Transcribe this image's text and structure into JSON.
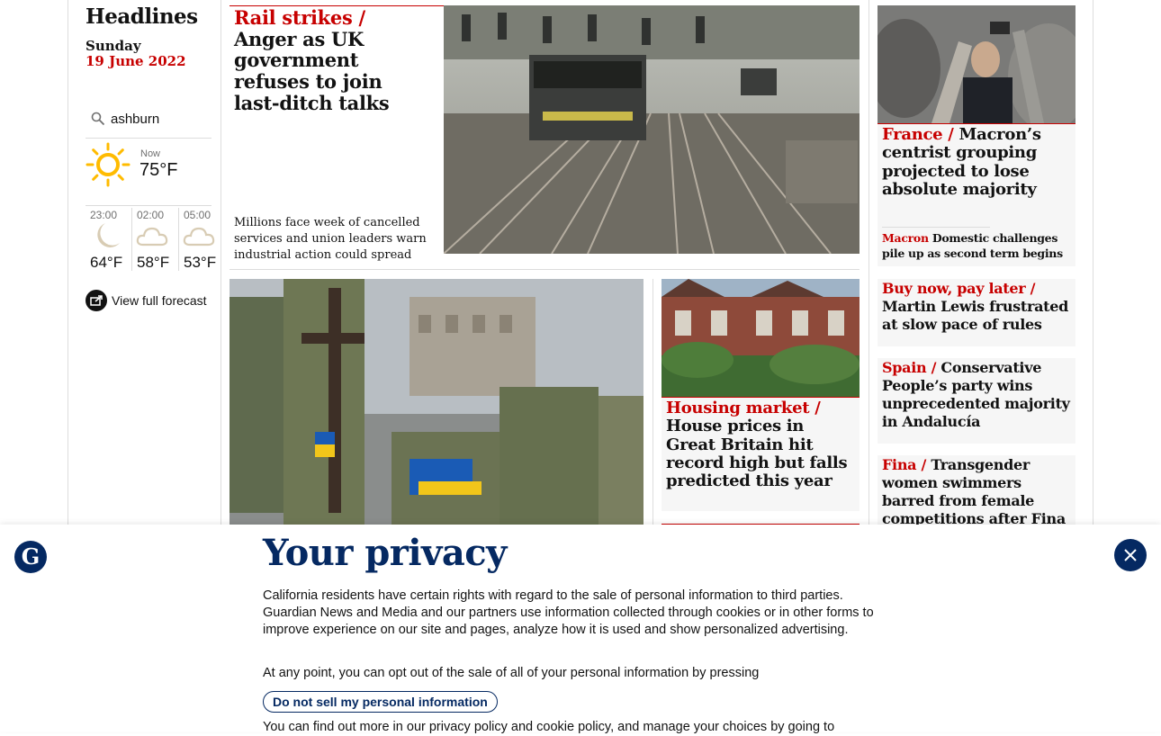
{
  "sidebar": {
    "title": "Headlines",
    "day": "Sunday",
    "date": "19 June 2022",
    "search_value": "ashburn",
    "now_label": "Now",
    "now_temp": "75°F",
    "forecast": [
      {
        "time": "23:00",
        "temp": "64°F",
        "icon": "moon-icon"
      },
      {
        "time": "02:00",
        "temp": "58°F",
        "icon": "cloud-icon"
      },
      {
        "time": "05:00",
        "temp": "53°F",
        "icon": "cloud-icon"
      }
    ],
    "full_forecast_label": "View full forecast"
  },
  "stories": {
    "main": {
      "kicker": "Rail strikes /",
      "headline": "Anger as UK government refuses to join last-ditch talks",
      "standfirst": "Millions face week of cancelled services and union leaders warn industrial action could spread"
    },
    "france": {
      "kicker": "France /",
      "headline": "Macron’s centrist grouping projected to lose absolute majority",
      "sub_kicker": "Macron",
      "sub_headline": "Domestic challenges pile up as second term begins"
    },
    "housing": {
      "kicker": "Housing market /",
      "headline": "House prices in Great Britain hit record high but falls predicted this year"
    },
    "bnpl": {
      "kicker": "Buy now, pay later /",
      "headline": "Martin Lewis frustrated at slow pace of rules"
    },
    "spain": {
      "kicker": "Spain /",
      "headline": "Conservative People’s party wins unprecedented majority in Andalucía"
    },
    "fina": {
      "kicker": "Fina /",
      "headline": "Transgender women swimmers barred from female competitions after Fina vote"
    }
  },
  "privacy": {
    "title": "Your privacy",
    "text1": "California residents have certain rights with regard to the sale of personal information to third parties. Guardian News and Media and our partners use information collected through cookies or in other forms to improve experience on our site and pages, analyze how it is used and show personalized advertising.",
    "text2": "At any point, you can opt out of the sale of all of your personal information by pressing",
    "button": "Do not sell my personal information",
    "text3": "You can find out more in our privacy policy and cookie policy, and manage your choices by going to"
  },
  "colors": {
    "news_red": "#c70000",
    "brand_blue": "#052962",
    "sun_yellow": "#ffbb00"
  }
}
